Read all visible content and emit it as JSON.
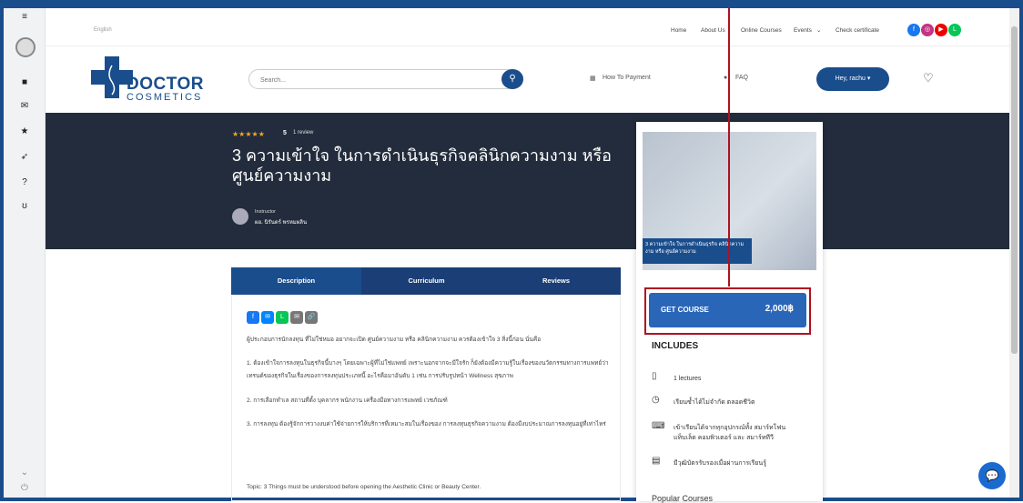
{
  "topbar": {
    "lang": "English",
    "nav": [
      "Home",
      "About Us",
      "Online Courses",
      "Events",
      "Check certificate"
    ]
  },
  "header": {
    "logo_main": "DOCTOR",
    "logo_sub": "COSMETICS",
    "search_placeholder": "Search...",
    "how_to_payment": "How To Payment",
    "faq": "FAQ",
    "user_button": "Hey, rachu",
    "heart_icon": "heart-icon"
  },
  "course": {
    "stars": "★★★★★",
    "rating": "5",
    "reviews": "1 review",
    "title": "3 ความเข้าใจ ในการดำเนินธุรกิจคลินิกความงาม หรือ ศูนย์ความงาม",
    "instructor_label": "Instructor",
    "instructor_name": "ผอ. นิรันดร์ พรหมผลิน"
  },
  "tabs": [
    "Description",
    "Curriculum",
    "Reviews"
  ],
  "description": {
    "p1": "ผู้ประกอบการนักลงทุน ที่ไม่ใช่หมอ อยากจะเปิด ศูนย์ความงาม หรือ คลินิกความงาม ควรต้องเข้าใจ 3 สิ่งนี้ก่อน นั่นคือ",
    "p2": "1. ต้องเข้าใจการลงทุนในธุรกิจนี้บางๆ โดยเฉพาะผู้ที่ไม่ใช่แพทย์ เพราะนอกจากจะมีใจรัก ก็ยังต้องมีความรู้ในเรื่องของนวัตกรรมทางการแพทย์ว่าเทรนด์ของธุรกิจในเรื่องของการลงทุนประเภทนี้ อะไรคือมาอันดับ 1 เช่น การปรับรูปหน้า Wellness สุขภาพ",
    "p3": "2. การเลือกทำเล สถานที่ตั้ง บุคลากร พนักงาน เครื่องมือทางการแพทย์ เวชภัณฑ์",
    "p4": "3. การลงทุน ต้องรู้จักการวางงบค่าใช้จ่ายการให้บริการที่เหมาะสมในเรื่องของ การลงทุนธุรกิจความงาม ต้องมีงบประมาณการลงทุนอยู่ที่เท่าไหร่",
    "p5": "Topic: 3 Things must be understood before opening the Aesthetic Clinic or Beauty Center."
  },
  "card": {
    "image_caption": "3 ความเข้าใจ ในการดำเนินธุรกิจ คลินิกความงาม หรือ ศูนย์ความงาม",
    "get_course": "GET COURSE",
    "price": "2,000฿",
    "includes": "INCLUDES",
    "items": [
      "1 lectures",
      "เรียนซ้ำได้ไม่จำกัด ตลอดชีวิต",
      "เข้าเรียนได้จากทุกอุปกรณ์ทั้ง สมาร์ทโฟน แท็บเล็ต คอมพิวเตอร์ และ สมาร์ททีวี",
      "มีวุฒิบัตรรับรองเมื่อผ่านการเรียนรู้"
    ],
    "related": "Popular Courses"
  },
  "colors": {
    "brand": "#1a4d8c",
    "hero": "#222c3c",
    "highlight": "#b01020"
  }
}
